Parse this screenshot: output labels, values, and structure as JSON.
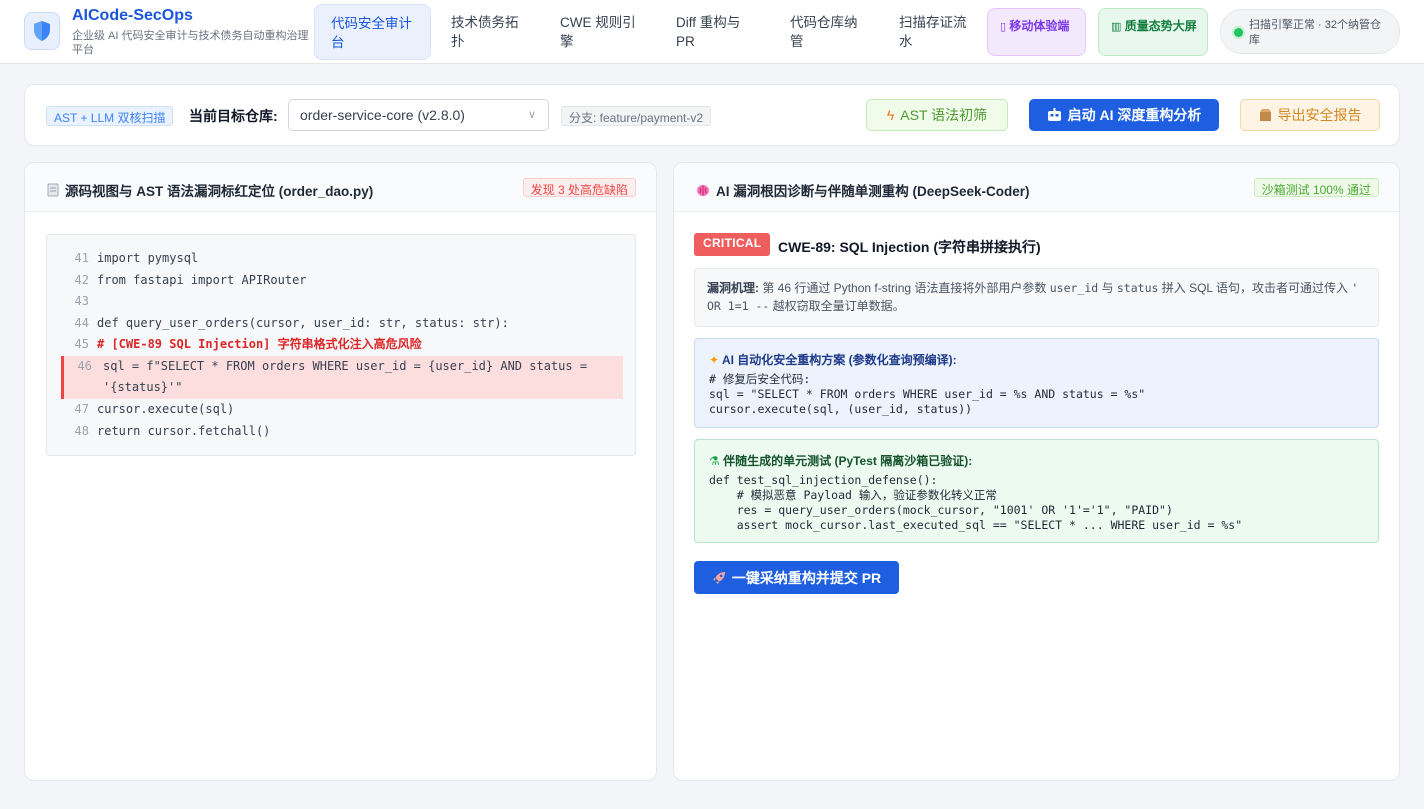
{
  "app": {
    "title": "AICode-SecOps",
    "subtitle": "企业级 AI 代码安全审计与技术债务自动重构治理平台"
  },
  "nav": {
    "items": [
      {
        "label": "代码安全审计台",
        "active": true
      },
      {
        "label": "技术债务拓扑"
      },
      {
        "label": "CWE 规则引擎"
      },
      {
        "label": "Diff 重构与 PR"
      },
      {
        "label": "代码仓库纳管"
      },
      {
        "label": "扫描存证流水"
      }
    ],
    "mobile_label": "移动体验端",
    "dashboard_label": "质量态势大屏"
  },
  "status": {
    "text": "扫描引擎正常 · 32个纳管仓库",
    "color": "#22c55e"
  },
  "toolbar": {
    "engine_tag": "AST + LLM 双核扫描",
    "repo_label": "当前目标仓库:",
    "repo_value": "order-service-core (v2.8.0)",
    "branch_tag": "分支: feature/payment-v2",
    "ast_button": "AST 语法初筛",
    "ai_button": "启动 AI 深度重构分析",
    "export_button": "导出安全报告"
  },
  "left_panel": {
    "title": "源码视图与 AST 语法漏洞标红定位 (order_dao.py)",
    "badge": "发现 3 处高危缺陷",
    "code": [
      {
        "ln": "41",
        "text": "import pymysql"
      },
      {
        "ln": "42",
        "text": "from fastapi import APIRouter"
      },
      {
        "ln": "43",
        "text": ""
      },
      {
        "ln": "44",
        "text": "def query_user_orders(cursor, user_id: str, status: str):"
      },
      {
        "ln": "45",
        "text": "# [CWE-89 SQL Injection] 字符串格式化注入高危风险"
      },
      {
        "ln": "46",
        "text": "sql = f\"SELECT * FROM orders WHERE user_id = {user_id} AND status = '{status}'\""
      },
      {
        "ln": "47",
        "text": "cursor.execute(sql)"
      },
      {
        "ln": "48",
        "text": "return cursor.fetchall()"
      }
    ]
  },
  "right_panel": {
    "title": "AI 漏洞根因诊断与伴随单测重构 (DeepSeek-Coder)",
    "badge": "沙箱测试 100% 通过",
    "severity": "CRITICAL",
    "vuln_title": "CWE-89: SQL Injection (字符串拼接执行)",
    "mechanism_label": "漏洞机理:",
    "mechanism_text_1": " 第 46 行通过 Python f-string 语法直接将外部用户参数 ",
    "mechanism_code_1": "user_id",
    "mechanism_text_2": " 与 ",
    "mechanism_code_2": "status",
    "mechanism_text_3": " 拼入 SQL 语句，攻击者可通过传入 ",
    "mechanism_code_3": "' OR 1=1 --",
    "mechanism_text_4": " 越权窃取全量订单数据。",
    "fix_title": "AI 自动化安全重构方案 (参数化查询预编译):",
    "fix_code": [
      "# 修复后安全代码:",
      "sql = \"SELECT * FROM orders WHERE user_id = %s AND status = %s\"",
      "cursor.execute(sql, (user_id, status))"
    ],
    "test_title": "伴随生成的单元测试 (PyTest 隔离沙箱已验证):",
    "test_code": [
      "def test_sql_injection_defense():",
      "    # 模拟恶意 Payload 输入，验证参数化转义正常",
      "    res = query_user_orders(mock_cursor, \"1001' OR '1'='1\", \"PAID\")",
      "    assert mock_cursor.last_executed_sql == \"SELECT * ... WHERE user_id = %s\""
    ],
    "pr_button": "一键采纳重构并提交 PR"
  },
  "icons": {
    "logo": "shield-icon",
    "mobile": "phone-icon",
    "dashboard": "bar-chart-icon",
    "ast": "lightning-icon",
    "ai": "robot-icon",
    "export": "package-icon",
    "file": "document-icon",
    "brain": "brain-icon",
    "fix": "sparkles-icon",
    "test": "test-tube-icon",
    "rocket": "rocket-icon"
  }
}
